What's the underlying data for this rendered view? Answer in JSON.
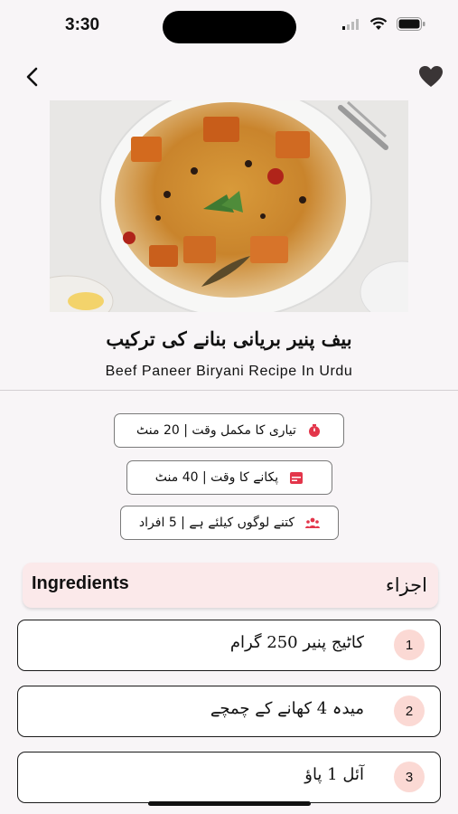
{
  "status_bar": {
    "time": "3:30"
  },
  "recipe": {
    "title_urdu": "بیف پنیر بریانی بنانے کی ترکیب",
    "title_english": "Beef Paneer Biryani Recipe In Urdu"
  },
  "info_chips": [
    {
      "text": "تیاری کا مکمل وقت | 20 منٹ",
      "icon": "timer-icon"
    },
    {
      "text": "پکانے کا وقت | 40 منٹ",
      "icon": "calendar-icon"
    },
    {
      "text": "کتنے لوگوں کیلئے ہے | 5 افراد",
      "icon": "people-icon"
    }
  ],
  "ingredients": {
    "title_english": "Ingredients",
    "title_urdu": "اجزاء",
    "items": [
      {
        "number": "1",
        "text": "کاٹیج پنیر 250 گرام"
      },
      {
        "number": "2",
        "text": "میدہ 4 کھانے کے چمچے"
      },
      {
        "number": "3",
        "text": "آئل 1 پاؤ"
      }
    ]
  },
  "colors": {
    "accent": "#e3354a",
    "ingredient_header_bg": "#fbe9ea",
    "number_badge_bg": "#fbd9d4"
  }
}
